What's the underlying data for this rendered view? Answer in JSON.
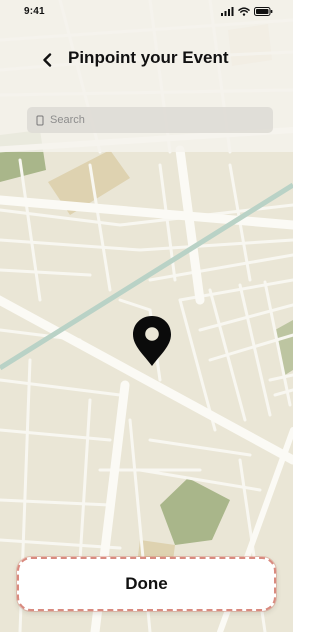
{
  "status_bar": {
    "time": "9:41",
    "icons": [
      "cellular-signal-icon",
      "wifi-icon",
      "battery-icon"
    ]
  },
  "header": {
    "back_icon": "chevron-left-icon",
    "title": "Pinpoint your Event"
  },
  "search": {
    "icon": "search-icon",
    "placeholder": "Search",
    "value": ""
  },
  "map": {
    "marker_icon": "map-pin-icon",
    "colors": {
      "land": "#eae6d6",
      "road": "#f8f7f1",
      "park": "#a9b68a",
      "sand": "#ded2b0",
      "water": "#b9d2c6"
    }
  },
  "footer": {
    "done_label": "Done",
    "accent": "#d98a7f"
  }
}
